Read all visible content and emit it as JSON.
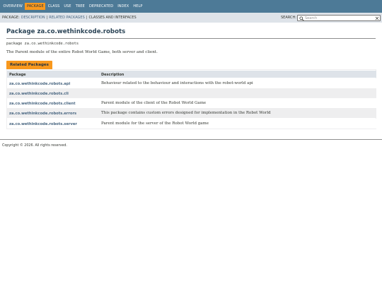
{
  "top_nav": {
    "items": [
      "Overview",
      "Package",
      "Class",
      "Use",
      "Tree",
      "Deprecated",
      "Index",
      "Help"
    ],
    "active": "Package"
  },
  "sub_nav": {
    "prefix": "Package:",
    "links": [
      "Description",
      "Related Packages",
      "Classes and Interfaces"
    ],
    "search_label": "Search:",
    "search_placeholder": "Search"
  },
  "page": {
    "title": "Package za.co.wethinkcode.robots",
    "signature": "package za.co.wethinkcode.robots",
    "description": "The Parent module of the entire Robot World Game, both server and client."
  },
  "related_packages": {
    "tab_label": "Related Packages",
    "headers": [
      "Package",
      "Description"
    ],
    "rows": [
      {
        "name": "za.co.wethinkcode.robots.api",
        "description": "Behaviour related to the behaviour and interactions with the robot-world api"
      },
      {
        "name": "za.co.wethinkcode.robots.cli",
        "description": ""
      },
      {
        "name": "za.co.wethinkcode.robots.client",
        "description": "Parent module of the client of the Robot World Game"
      },
      {
        "name": "za.co.wethinkcode.robots.errors",
        "description": "This package contains custom errors designed for implementation in the Robot World"
      },
      {
        "name": "za.co.wethinkcode.robots.server",
        "description": "Parent module for the server of the Robot World game"
      }
    ]
  },
  "footer": {
    "copyright": "Copyright © 2026. All rights reserved."
  },
  "colors": {
    "nav_bg": "#4d7a97",
    "sub_nav_bg": "#dee3e9",
    "accent": "#f8981d",
    "link": "#4a6782"
  }
}
